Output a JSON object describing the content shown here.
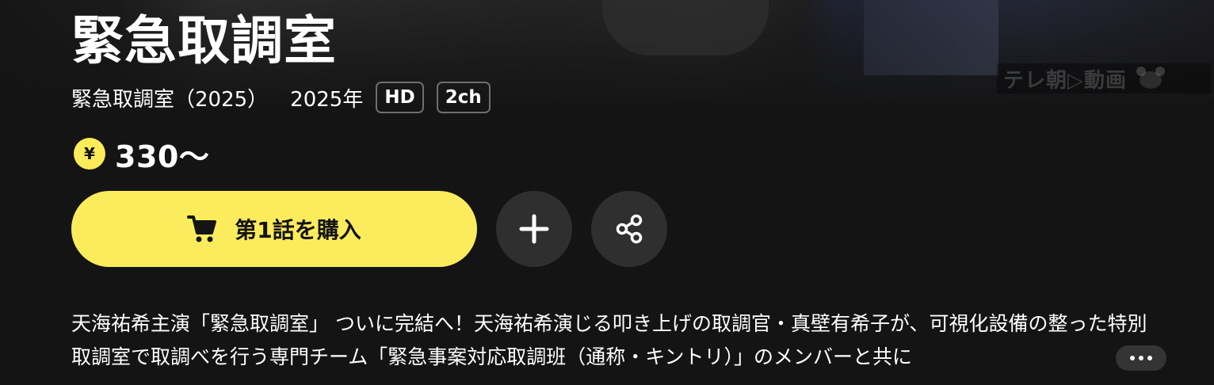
{
  "watermark": {
    "text": "テレ朝▷動画"
  },
  "title": "緊急取調室",
  "meta": {
    "series": "緊急取調室（2025）",
    "year": "2025年",
    "badges": [
      "HD",
      "2ch"
    ]
  },
  "price": {
    "currency_icon": "yen-coin-icon",
    "currency_symbol": "¥",
    "text": "330〜",
    "accent_color": "#fdeb5a"
  },
  "actions": {
    "buy_label": "第1話を購入",
    "buy_icon": "cart-icon",
    "add_icon": "plus-icon",
    "share_icon": "share-icon",
    "more_icon": "more-icon"
  },
  "description": "天海祐希主演「緊急取調室」 ついに完結へ！天海祐希演じる叩き上げの取調官・真壁有希子が、可視化設備の整った特別取調室で取調べを行う専門チーム「緊急事案対応取調班（通称・キントリ）」のメンバーと共に"
}
